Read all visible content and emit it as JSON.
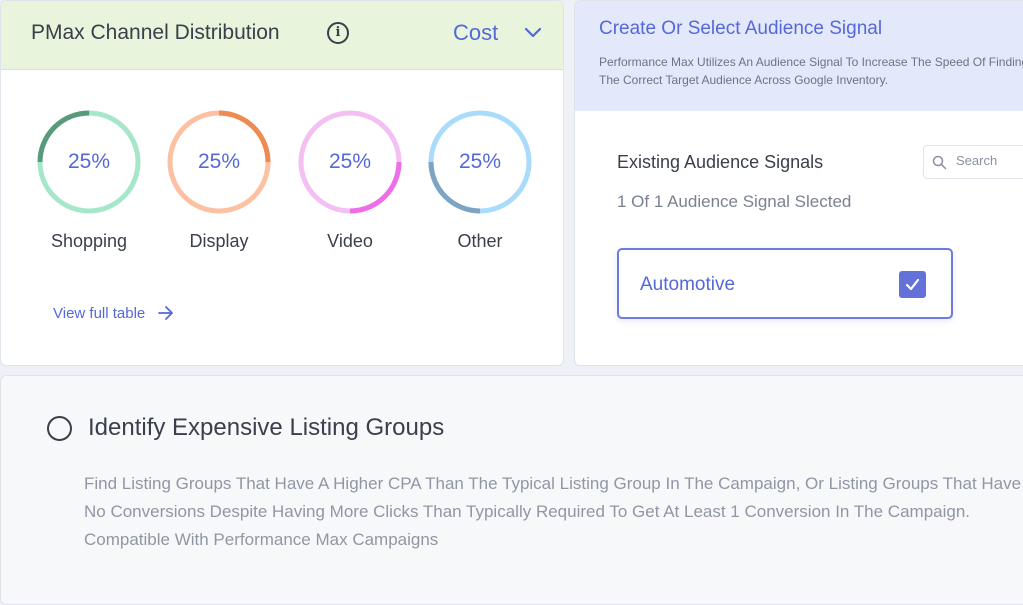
{
  "channel_card": {
    "title": "PMax Channel Distribution",
    "info_icon": "info-icon",
    "metric_dropdown": {
      "selected": "Cost",
      "icon": "chevron-down-icon"
    },
    "rings": [
      {
        "label": "Shopping",
        "percent_text": "25%",
        "fraction": 0.25,
        "track_color": "#a6e6c9",
        "accent_color": "#5a9a7c"
      },
      {
        "label": "Display",
        "percent_text": "25%",
        "fraction": 0.25,
        "track_color": "#fbc1a2",
        "accent_color": "#ee8a52"
      },
      {
        "label": "Video",
        "percent_text": "25%",
        "fraction": 0.25,
        "track_color": "#f4bff2",
        "accent_color": "#ee6ee8"
      },
      {
        "label": "Other",
        "percent_text": "25%",
        "fraction": 0.25,
        "track_color": "#a9dbfb",
        "accent_color": "#7ea4c4"
      }
    ],
    "view_link": {
      "label": "View full table",
      "icon": "arrow-right-icon"
    }
  },
  "audience_card": {
    "title": "Create Or Select Audience Signal",
    "description": "Performance Max Utilizes An Audience Signal To Increase The Speed Of Finding The Correct Target Audience Across Google Inventory.",
    "existing_heading": "Existing Audience Signals",
    "selected_count": "1 Of 1 Audience Signal Slected",
    "search": {
      "placeholder": "Search",
      "icon": "search-icon"
    },
    "options": [
      {
        "label": "Automotive",
        "checked": true,
        "icon": "checkmark-icon"
      }
    ]
  },
  "listing_card": {
    "title": "Identify Expensive Listing Groups",
    "description": "Find Listing Groups That Have A Higher CPA Than The Typical Listing Group In The Campaign, Or Listing Groups That Have No Conversions Despite Having More Clicks Than Typically Required To Get At Least 1 Conversion In The Campaign. Compatible With Performance Max Campaigns"
  },
  "colors": {
    "accent": "#5568d8",
    "header_green": "#e8f5dc",
    "header_blue": "#e3e8fb",
    "text": "#3a3f4b",
    "muted": "#9096a4"
  }
}
